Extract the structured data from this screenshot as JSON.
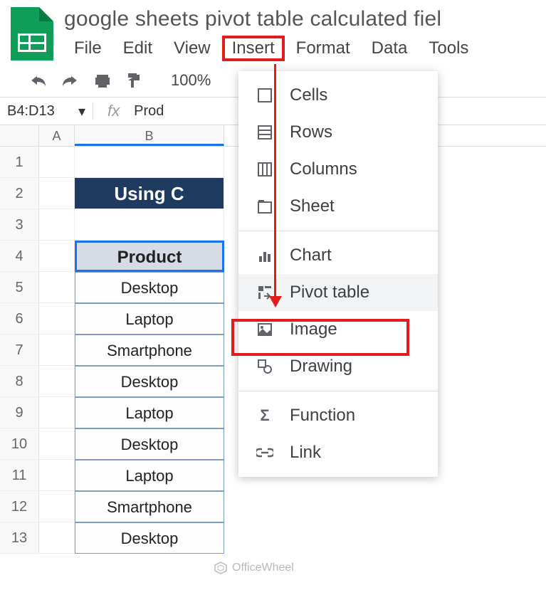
{
  "doc": {
    "title": "google sheets pivot table calculated fiel"
  },
  "menubar": [
    "File",
    "Edit",
    "View",
    "Insert",
    "Format",
    "Data",
    "Tools"
  ],
  "toolbar": {
    "zoom": "100%"
  },
  "namebox": {
    "range": "B4:D13",
    "formula": "Prod"
  },
  "columns": [
    "A",
    "B"
  ],
  "rows": [
    "1",
    "2",
    "3",
    "4",
    "5",
    "6",
    "7",
    "8",
    "9",
    "10",
    "11",
    "12",
    "13"
  ],
  "banner": "Using C",
  "table": {
    "header": "Product",
    "data": [
      "Desktop",
      "Laptop",
      "Smartphone",
      "Desktop",
      "Laptop",
      "Desktop",
      "Laptop",
      "Smartphone",
      "Desktop"
    ]
  },
  "insert_menu": {
    "cells": "Cells",
    "rows": "Rows",
    "columns": "Columns",
    "sheet": "Sheet",
    "chart": "Chart",
    "pivot": "Pivot table",
    "image": "Image",
    "drawing": "Drawing",
    "function": "Function",
    "link": "Link"
  },
  "watermark": "OfficeWheel",
  "highlight": {
    "menu_index": 3,
    "menu_item": "Insert",
    "target_item": "pivot"
  }
}
